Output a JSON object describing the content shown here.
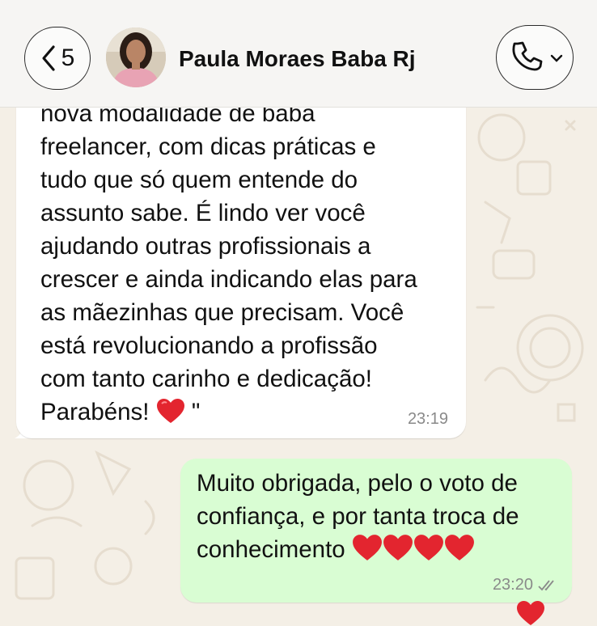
{
  "header": {
    "back_count": "5",
    "contact_name": "Paula Moraes Baba Rj"
  },
  "messages": [
    {
      "direction": "incoming",
      "text": "nova modalidade de babá\nfreelancer, com dicas práticas e\ntudo que só quem entende do\nassunto sabe. É lindo ver você\najudando outras profissionais a\ncrescer e ainda indicando elas para\nas mãezinhas que precisam. Você\nestá revolucionando a profissão\ncom tanto carinho e dedicação!\nParabéns!",
      "suffix": "\"",
      "time": "23:19"
    },
    {
      "direction": "outgoing",
      "text": "Muito obrigada, pelo o voto de\nconfiança, e por tanta troca de\nconhecimento",
      "time": "23:20",
      "status": "read"
    }
  ],
  "icons": {
    "back": "chevron-left-icon",
    "call": "phone-icon",
    "call_menu": "chevron-down-icon",
    "heart": "red-heart-icon",
    "read_receipt": "double-check-icon"
  },
  "colors": {
    "background": "#f4efe6",
    "incoming_bubble": "#ffffff",
    "outgoing_bubble": "#d9fdd3",
    "heart": "#e3252f"
  }
}
